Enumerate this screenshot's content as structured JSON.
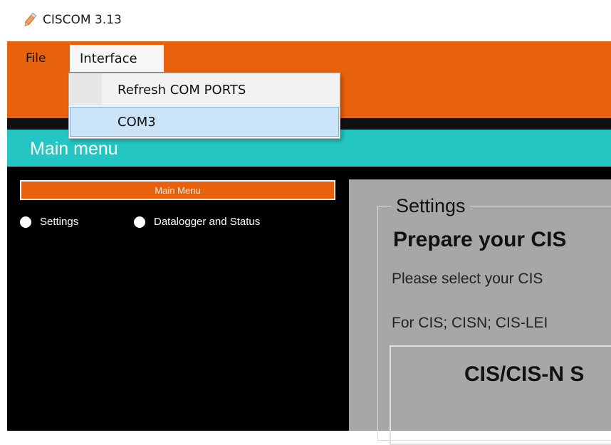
{
  "window": {
    "title": "CISCOM 3.13",
    "icon": "pen-icon"
  },
  "menubar": {
    "file_label": "File",
    "interface_label": "Interface",
    "accent_color": "#e8610c"
  },
  "interface_menu": {
    "items": [
      {
        "label": "Refresh COM PORTS",
        "selected": false
      },
      {
        "label": "COM3",
        "selected": true
      }
    ]
  },
  "header": {
    "title": "Main menu",
    "color": "#23c6c2"
  },
  "left_panel": {
    "menu_title": "Main Menu",
    "options": [
      {
        "label": "Settings"
      },
      {
        "label": "Datalogger and Status"
      }
    ]
  },
  "settings_panel": {
    "legend": "Settings",
    "heading": "Prepare your CIS",
    "line1": "Please select your CIS",
    "line2": "For CIS; CISN; CIS-LEI",
    "box_title": "CIS/CIS-N S"
  }
}
